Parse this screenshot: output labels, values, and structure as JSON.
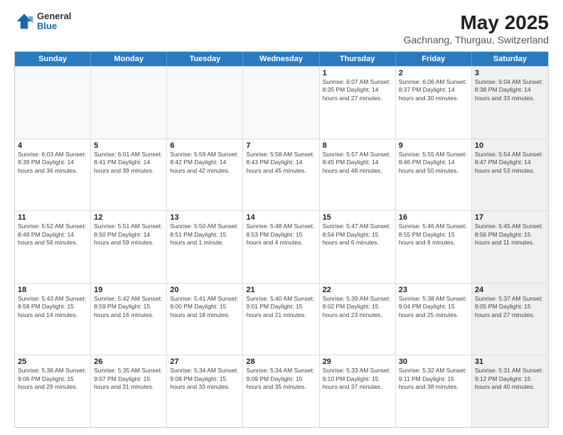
{
  "header": {
    "logo_general": "General",
    "logo_blue": "Blue",
    "title": "May 2025",
    "subtitle": "Gachnang, Thurgau, Switzerland"
  },
  "calendar": {
    "weekdays": [
      "Sunday",
      "Monday",
      "Tuesday",
      "Wednesday",
      "Thursday",
      "Friday",
      "Saturday"
    ],
    "rows": [
      [
        {
          "day": "",
          "info": "",
          "empty": true
        },
        {
          "day": "",
          "info": "",
          "empty": true
        },
        {
          "day": "",
          "info": "",
          "empty": true
        },
        {
          "day": "",
          "info": "",
          "empty": true
        },
        {
          "day": "1",
          "info": "Sunrise: 6:07 AM\nSunset: 8:35 PM\nDaylight: 14 hours\nand 27 minutes."
        },
        {
          "day": "2",
          "info": "Sunrise: 6:06 AM\nSunset: 8:37 PM\nDaylight: 14 hours\nand 30 minutes."
        },
        {
          "day": "3",
          "info": "Sunrise: 6:04 AM\nSunset: 8:38 PM\nDaylight: 14 hours\nand 33 minutes.",
          "shaded": true
        }
      ],
      [
        {
          "day": "4",
          "info": "Sunrise: 6:03 AM\nSunset: 8:39 PM\nDaylight: 14 hours\nand 36 minutes."
        },
        {
          "day": "5",
          "info": "Sunrise: 6:01 AM\nSunset: 8:41 PM\nDaylight: 14 hours\nand 39 minutes."
        },
        {
          "day": "6",
          "info": "Sunrise: 5:59 AM\nSunset: 8:42 PM\nDaylight: 14 hours\nand 42 minutes."
        },
        {
          "day": "7",
          "info": "Sunrise: 5:58 AM\nSunset: 8:43 PM\nDaylight: 14 hours\nand 45 minutes."
        },
        {
          "day": "8",
          "info": "Sunrise: 5:57 AM\nSunset: 8:45 PM\nDaylight: 14 hours\nand 48 minutes."
        },
        {
          "day": "9",
          "info": "Sunrise: 5:55 AM\nSunset: 8:46 PM\nDaylight: 14 hours\nand 50 minutes."
        },
        {
          "day": "10",
          "info": "Sunrise: 5:54 AM\nSunset: 8:47 PM\nDaylight: 14 hours\nand 53 minutes.",
          "shaded": true
        }
      ],
      [
        {
          "day": "11",
          "info": "Sunrise: 5:52 AM\nSunset: 8:49 PM\nDaylight: 14 hours\nand 56 minutes."
        },
        {
          "day": "12",
          "info": "Sunrise: 5:51 AM\nSunset: 8:50 PM\nDaylight: 14 hours\nand 59 minutes."
        },
        {
          "day": "13",
          "info": "Sunrise: 5:50 AM\nSunset: 8:51 PM\nDaylight: 15 hours\nand 1 minute."
        },
        {
          "day": "14",
          "info": "Sunrise: 5:48 AM\nSunset: 8:53 PM\nDaylight: 15 hours\nand 4 minutes."
        },
        {
          "day": "15",
          "info": "Sunrise: 5:47 AM\nSunset: 8:54 PM\nDaylight: 15 hours\nand 6 minutes."
        },
        {
          "day": "16",
          "info": "Sunrise: 5:46 AM\nSunset: 8:55 PM\nDaylight: 15 hours\nand 9 minutes."
        },
        {
          "day": "17",
          "info": "Sunrise: 5:45 AM\nSunset: 8:56 PM\nDaylight: 15 hours\nand 11 minutes.",
          "shaded": true
        }
      ],
      [
        {
          "day": "18",
          "info": "Sunrise: 5:43 AM\nSunset: 8:58 PM\nDaylight: 15 hours\nand 14 minutes."
        },
        {
          "day": "19",
          "info": "Sunrise: 5:42 AM\nSunset: 8:59 PM\nDaylight: 15 hours\nand 16 minutes."
        },
        {
          "day": "20",
          "info": "Sunrise: 5:41 AM\nSunset: 9:00 PM\nDaylight: 15 hours\nand 18 minutes."
        },
        {
          "day": "21",
          "info": "Sunrise: 5:40 AM\nSunset: 9:01 PM\nDaylight: 15 hours\nand 21 minutes."
        },
        {
          "day": "22",
          "info": "Sunrise: 5:39 AM\nSunset: 9:02 PM\nDaylight: 15 hours\nand 23 minutes."
        },
        {
          "day": "23",
          "info": "Sunrise: 5:38 AM\nSunset: 9:04 PM\nDaylight: 15 hours\nand 25 minutes."
        },
        {
          "day": "24",
          "info": "Sunrise: 5:37 AM\nSunset: 9:05 PM\nDaylight: 15 hours\nand 27 minutes.",
          "shaded": true
        }
      ],
      [
        {
          "day": "25",
          "info": "Sunrise: 5:36 AM\nSunset: 9:06 PM\nDaylight: 15 hours\nand 29 minutes."
        },
        {
          "day": "26",
          "info": "Sunrise: 5:35 AM\nSunset: 9:07 PM\nDaylight: 15 hours\nand 31 minutes."
        },
        {
          "day": "27",
          "info": "Sunrise: 5:34 AM\nSunset: 9:08 PM\nDaylight: 15 hours\nand 33 minutes."
        },
        {
          "day": "28",
          "info": "Sunrise: 5:34 AM\nSunset: 9:09 PM\nDaylight: 15 hours\nand 35 minutes."
        },
        {
          "day": "29",
          "info": "Sunrise: 5:33 AM\nSunset: 9:10 PM\nDaylight: 15 hours\nand 37 minutes."
        },
        {
          "day": "30",
          "info": "Sunrise: 5:32 AM\nSunset: 9:11 PM\nDaylight: 15 hours\nand 38 minutes."
        },
        {
          "day": "31",
          "info": "Sunrise: 5:31 AM\nSunset: 9:12 PM\nDaylight: 15 hours\nand 40 minutes.",
          "shaded": true
        }
      ]
    ]
  }
}
